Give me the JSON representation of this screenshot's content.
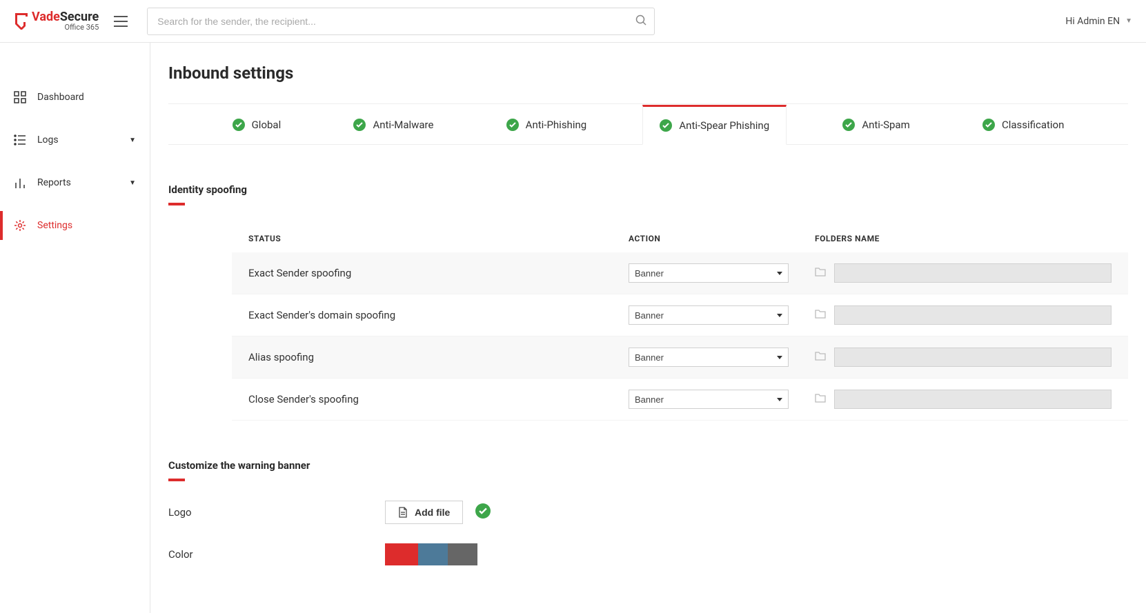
{
  "brand": {
    "line1a": "Vade",
    "line1b": "Secure",
    "line2": "Office 365"
  },
  "search": {
    "placeholder": "Search for the sender, the recipient..."
  },
  "user": {
    "label": "Hi Admin EN"
  },
  "sidebar": {
    "items": [
      {
        "label": "Dashboard",
        "icon": "grid",
        "expandable": false,
        "active": false
      },
      {
        "label": "Logs",
        "icon": "list",
        "expandable": true,
        "active": false
      },
      {
        "label": "Reports",
        "icon": "bar",
        "expandable": true,
        "active": false
      },
      {
        "label": "Settings",
        "icon": "gear",
        "expandable": false,
        "active": true
      }
    ]
  },
  "page": {
    "title": "Inbound settings"
  },
  "tabs": [
    {
      "label": "Global",
      "ok": true,
      "active": false
    },
    {
      "label": "Anti-Malware",
      "ok": true,
      "active": false
    },
    {
      "label": "Anti-Phishing",
      "ok": true,
      "active": false
    },
    {
      "label": "Anti-Spear Phishing",
      "ok": true,
      "active": true
    },
    {
      "label": "Anti-Spam",
      "ok": true,
      "active": false
    },
    {
      "label": "Classification",
      "ok": true,
      "active": false
    }
  ],
  "identity": {
    "title": "Identity spoofing",
    "headers": {
      "status": "STATUS",
      "action": "ACTION",
      "folders": "FOLDERS NAME"
    },
    "rows": [
      {
        "label": "Exact Sender spoofing",
        "action": "Banner",
        "folder": ""
      },
      {
        "label": "Exact Sender's domain spoofing",
        "action": "Banner",
        "folder": ""
      },
      {
        "label": "Alias spoofing",
        "action": "Banner",
        "folder": ""
      },
      {
        "label": "Close Sender's spoofing",
        "action": "Banner",
        "folder": ""
      }
    ]
  },
  "banner": {
    "title": "Customize the warning banner",
    "logo_label": "Logo",
    "add_file": "Add file",
    "color_label": "Color",
    "colors": {
      "red": "#dd2c2c",
      "blue": "#4d7a99",
      "gray": "#666666"
    }
  }
}
